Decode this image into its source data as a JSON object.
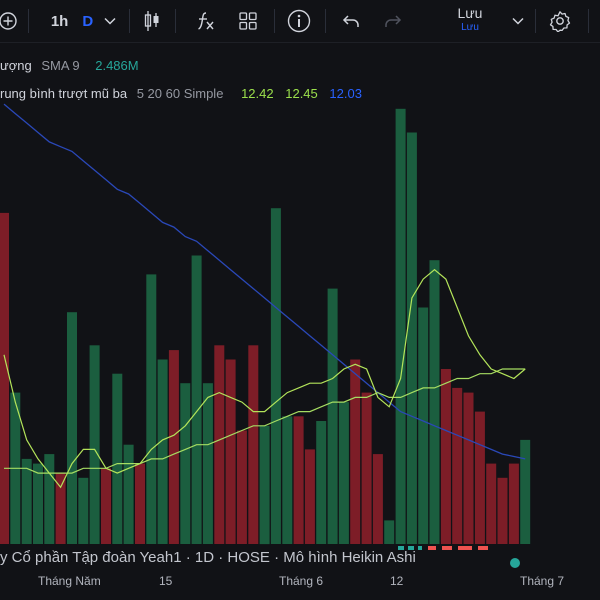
{
  "toolbar": {
    "interval": "1h",
    "interval_accent": "D",
    "save_label": "Lưu",
    "save_sub": "Lưu",
    "icons": [
      "add-symbol-icon",
      "chevron-down-icon",
      "candlestick-icon",
      "indicators-icon",
      "templates-icon",
      "info-icon",
      "undo-icon",
      "redo-icon",
      "settings-icon"
    ]
  },
  "legend": {
    "volume": {
      "name": "ượng",
      "sub": "SMA 9",
      "value": "2.486M",
      "value_color": "#26a69a"
    },
    "ema": {
      "name": "rung bình trượt mũ ba",
      "params": "5 20 60 Simple",
      "values": [
        "12.42",
        "12.45",
        "12.03"
      ],
      "colors": [
        "#9be04c",
        "#9be04c",
        "#2962ff"
      ]
    }
  },
  "bottom_title": "y Cổ phần Tập đoàn Yeah1 · 1D · HOSE · Mô hình Heikin Ashi",
  "time_axis": [
    "Tháng Năm",
    "15",
    "Tháng 6",
    "12",
    "Tháng 7"
  ],
  "colors": {
    "up": "#1b5e3f",
    "down": "#7d1d27",
    "sma": "#2a48b8",
    "ema1": "#b4e45a",
    "ema2": "#a6dd62"
  },
  "chart_data": {
    "type": "bar",
    "bars": [
      {
        "v": 70,
        "d": "down"
      },
      {
        "v": 32,
        "d": "up"
      },
      {
        "v": 18,
        "d": "up"
      },
      {
        "v": 17,
        "d": "up"
      },
      {
        "v": 19,
        "d": "up"
      },
      {
        "v": 15,
        "d": "down"
      },
      {
        "v": 49,
        "d": "up"
      },
      {
        "v": 14,
        "d": "up"
      },
      {
        "v": 42,
        "d": "up"
      },
      {
        "v": 16,
        "d": "down"
      },
      {
        "v": 36,
        "d": "up"
      },
      {
        "v": 21,
        "d": "up"
      },
      {
        "v": 17,
        "d": "down"
      },
      {
        "v": 57,
        "d": "up"
      },
      {
        "v": 39,
        "d": "up"
      },
      {
        "v": 41,
        "d": "down"
      },
      {
        "v": 34,
        "d": "up"
      },
      {
        "v": 61,
        "d": "up"
      },
      {
        "v": 34,
        "d": "up"
      },
      {
        "v": 42,
        "d": "down"
      },
      {
        "v": 39,
        "d": "down"
      },
      {
        "v": 24,
        "d": "down"
      },
      {
        "v": 42,
        "d": "down"
      },
      {
        "v": 25,
        "d": "up"
      },
      {
        "v": 71,
        "d": "up"
      },
      {
        "v": 27,
        "d": "up"
      },
      {
        "v": 27,
        "d": "down"
      },
      {
        "v": 20,
        "d": "down"
      },
      {
        "v": 26,
        "d": "up"
      },
      {
        "v": 54,
        "d": "up"
      },
      {
        "v": 30,
        "d": "up"
      },
      {
        "v": 39,
        "d": "down"
      },
      {
        "v": 32,
        "d": "down"
      },
      {
        "v": 19,
        "d": "down"
      },
      {
        "v": 5,
        "d": "up"
      },
      {
        "v": 92,
        "d": "up"
      },
      {
        "v": 87,
        "d": "up"
      },
      {
        "v": 50,
        "d": "up"
      },
      {
        "v": 60,
        "d": "up"
      },
      {
        "v": 37,
        "d": "down"
      },
      {
        "v": 33,
        "d": "down"
      },
      {
        "v": 32,
        "d": "down"
      },
      {
        "v": 28,
        "d": "down"
      },
      {
        "v": 17,
        "d": "down"
      },
      {
        "v": 14,
        "d": "down"
      },
      {
        "v": 17,
        "d": "down"
      },
      {
        "v": 22,
        "d": "up"
      }
    ],
    "sma": [
      93,
      91,
      89,
      87,
      85,
      84,
      83,
      81,
      79,
      77,
      75,
      74,
      72,
      70,
      68,
      67,
      65,
      64,
      62,
      60,
      58,
      56,
      54,
      52,
      50,
      48,
      46,
      44,
      42,
      40,
      38,
      36,
      34,
      32,
      30,
      28,
      27,
      26,
      25,
      24,
      23,
      22,
      21,
      20,
      19,
      18.5,
      18
    ],
    "ema_fast": [
      40,
      30,
      22,
      18,
      15,
      12,
      17,
      20,
      20,
      16,
      15,
      16,
      17,
      20,
      22,
      23,
      25,
      28,
      31,
      32,
      31,
      30,
      28,
      28,
      30,
      32,
      33,
      34,
      34,
      35,
      37,
      38,
      37,
      31,
      29,
      35,
      52,
      56,
      58,
      56,
      50,
      44,
      40,
      37,
      36,
      35,
      37
    ],
    "ema_slow": [
      16,
      16,
      16,
      15,
      15,
      15,
      15,
      16,
      16,
      16,
      17,
      17,
      17,
      18,
      18,
      19,
      20,
      21,
      21,
      22,
      23,
      24,
      25,
      25,
      26,
      27,
      28,
      28,
      29,
      30,
      30,
      31,
      31,
      32,
      31,
      31,
      32,
      33,
      33,
      34,
      35,
      35,
      36,
      36,
      37,
      37,
      37
    ]
  }
}
